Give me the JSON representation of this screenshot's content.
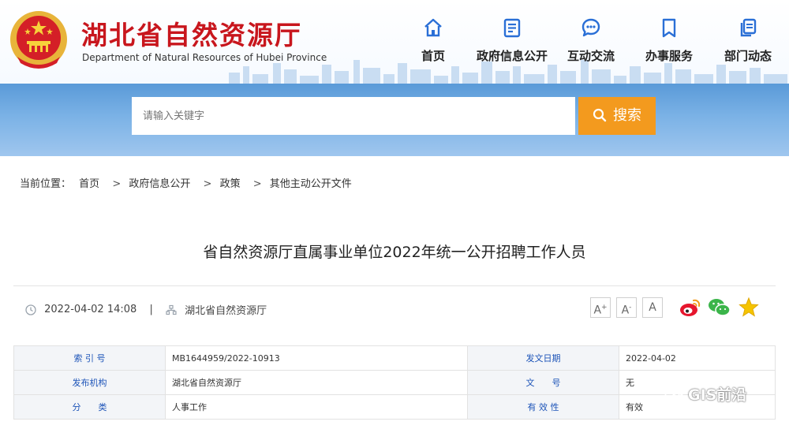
{
  "site": {
    "title": "湖北省自然资源厅",
    "subtitle": "Department of Natural Resources of Hubei Province"
  },
  "nav": {
    "items": [
      {
        "label": "首页",
        "icon": "home-icon"
      },
      {
        "label": "政府信息公开",
        "icon": "document-icon"
      },
      {
        "label": "互动交流",
        "icon": "chat-icon"
      },
      {
        "label": "办事服务",
        "icon": "bookmark-icon"
      },
      {
        "label": "部门动态",
        "icon": "copy-icon"
      }
    ]
  },
  "search": {
    "placeholder": "请输入关键字",
    "button_label": "搜索"
  },
  "breadcrumb": {
    "prefix": "当前位置：",
    "items": [
      "首页",
      "政府信息公开",
      "政策",
      "其他主动公开文件"
    ],
    "separator": ">"
  },
  "article": {
    "title": "省自然资源厅直属事业单位2022年统一公开招聘工作人员",
    "datetime": "2022-04-02 14:08",
    "divider": "|",
    "organization": "湖北省自然资源厅"
  },
  "font_controls": [
    {
      "glyph": "A",
      "mark": "+"
    },
    {
      "glyph": "A",
      "mark": "-"
    },
    {
      "glyph": "A",
      "mark": ""
    }
  ],
  "share": [
    "weibo-icon",
    "wechat-icon",
    "favorite-star-icon"
  ],
  "info_table": {
    "rows": [
      {
        "k1": "索 引 号",
        "v1": "MB1644959/2022-10913",
        "k2": "发文日期",
        "v2": "2022-04-02"
      },
      {
        "k1": "发布机构",
        "v1": "湖北省自然资源厅",
        "k2": "文　　号",
        "v2": "无"
      },
      {
        "k1": "分　　类",
        "v1": "人事工作",
        "k2": "有 效 性",
        "v2": "有效"
      }
    ]
  },
  "watermark": {
    "text": "GIS前沿"
  },
  "colors": {
    "brand_red": "#c8161d",
    "nav_blue": "#2a6fd6",
    "search_orange": "#f39a1e",
    "table_key_blue": "#1d54b8"
  }
}
